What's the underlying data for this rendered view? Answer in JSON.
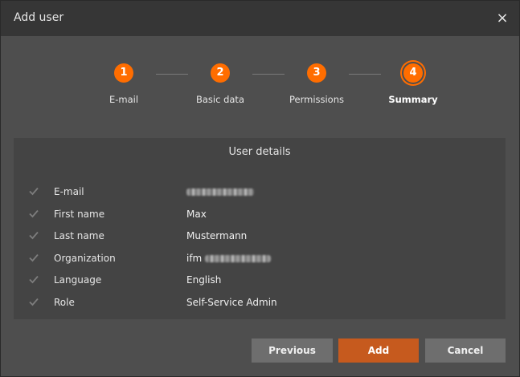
{
  "dialog": {
    "title": "Add user",
    "close_symbol": "×",
    "close_icon": "close-icon"
  },
  "stepper": {
    "steps": [
      {
        "number": "1",
        "label": "E-mail"
      },
      {
        "number": "2",
        "label": "Basic data"
      },
      {
        "number": "3",
        "label": "Permissions"
      },
      {
        "number": "4",
        "label": "Summary",
        "current": true
      }
    ]
  },
  "details": {
    "title": "User details",
    "rows": [
      {
        "key": "E-mail",
        "value": ""
      },
      {
        "key": "First name",
        "value": "Max"
      },
      {
        "key": "Last name",
        "value": "Mustermann"
      },
      {
        "key": "Organization",
        "value": "ifm"
      },
      {
        "key": "Language",
        "value": "English"
      },
      {
        "key": "Role",
        "value": "Self-Service Admin"
      }
    ]
  },
  "buttons": {
    "previous": "Previous",
    "add": "Add",
    "cancel": "Cancel"
  },
  "colors": {
    "accent": "#ff6d00",
    "add_button": "#c65a1e"
  }
}
